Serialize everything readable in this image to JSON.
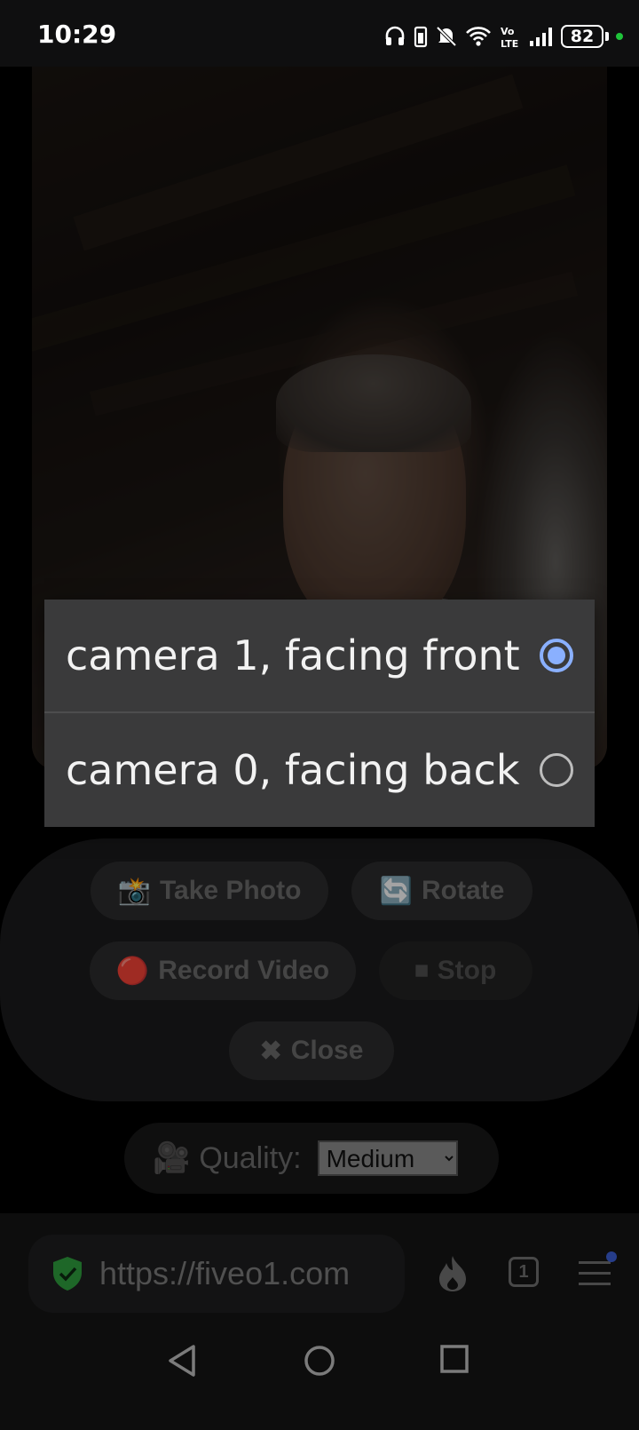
{
  "status_bar": {
    "time": "10:29",
    "battery": "82",
    "volte": "Vo\nLTE"
  },
  "camera_dialog": {
    "options": [
      {
        "label": "camera 1, facing front",
        "selected": true
      },
      {
        "label": "camera 0, facing back",
        "selected": false
      }
    ]
  },
  "controls": {
    "take_photo": "Take Photo",
    "take_photo_icon": "📸",
    "rotate": "Rotate",
    "rotate_icon": "🔄",
    "record_video": "Record Video",
    "record_icon": "🔴",
    "stop": "Stop",
    "stop_icon": "⏹",
    "close": "Close",
    "close_icon": "✖"
  },
  "quality": {
    "icon": "🎥",
    "label": "Quality:",
    "selected": "Medium"
  },
  "browser": {
    "url": "https://fiveo1.com",
    "tab_count": "1"
  },
  "colors": {
    "accent_radio": "#8ab0ff",
    "shield_green": "#2f9e3e"
  }
}
